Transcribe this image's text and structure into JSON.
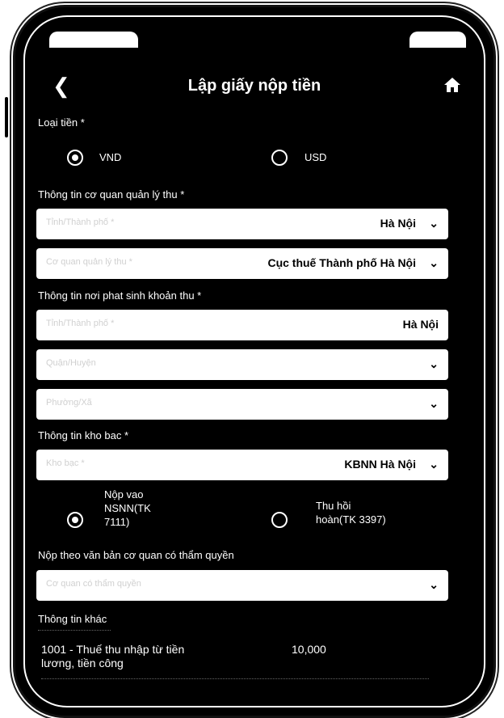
{
  "header": {
    "title": "Lập giấy nộp tiền",
    "back_icon": "chevron-left-icon",
    "home_icon": "home-icon"
  },
  "currency": {
    "label": "Loại tiền *",
    "options": [
      {
        "label": "VND",
        "selected": true
      },
      {
        "label": "USD",
        "selected": false
      }
    ]
  },
  "agency": {
    "label": "Thông tin cơ quan quản lý thu *",
    "province": {
      "placeholder": "Tỉnh/Thành phố *",
      "value": "Hà Nội"
    },
    "tax_office": {
      "placeholder": "Cơ quan quản lý thu *",
      "value": "Cục thuế Thành phố Hà Nội"
    }
  },
  "origin": {
    "label": "Thông tin nơi phat sinh khoản thu *",
    "province": {
      "placeholder": "Tỉnh/Thành phố *",
      "value": "Hà Nội"
    },
    "district": {
      "placeholder": "Quận/Huyện"
    },
    "ward": {
      "placeholder": "Phường/Xã"
    }
  },
  "treasury": {
    "label": "Thông tin kho bac *",
    "treasury_field": {
      "placeholder": "Kho bạc *",
      "value": "KBNN Hà Nội"
    },
    "options": [
      {
        "label": "Nộp vao NSNN(TK 7111)",
        "lines": [
          "Nộp vao",
          "NSNN(TK",
          "7111)"
        ],
        "selected": true
      },
      {
        "label": "Thu hồi hoàn(TK 3397)",
        "lines": [
          "Thu hồi",
          "hoàn(TK 3397)"
        ],
        "selected": false
      }
    ]
  },
  "authority": {
    "label": "Nộp theo văn bản cơ quan có thẩm quyền",
    "placeholder": "Cơ quan có thẩm quyền"
  },
  "other": {
    "label": "Thông tin khác",
    "items": [
      {
        "lines": [
          "1001 - Thuế thu nhập từ tiền",
          "lương, tiền công"
        ],
        "amount": "10,000"
      }
    ]
  },
  "colors": {
    "background": "#000000",
    "field": "#ffffff",
    "text": "#ffffff"
  }
}
